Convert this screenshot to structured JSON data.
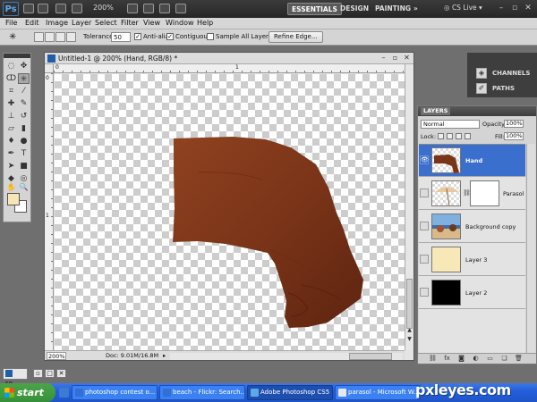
{
  "app": {
    "logo": "Ps",
    "zoom": "200%",
    "workspaces": [
      "ESSENTIALS",
      "DESIGN",
      "PAINTING"
    ],
    "more": "»",
    "cs_live": "CS Live"
  },
  "menu": [
    "File",
    "Edit",
    "Image",
    "Layer",
    "Select",
    "Filter",
    "View",
    "Window",
    "Help"
  ],
  "options": {
    "tolerance_label": "Tolerance:",
    "tolerance_value": "50",
    "anti_alias": "Anti-alias",
    "contiguous": "Contiguous",
    "sample_all": "Sample All Layers",
    "refine_edge": "Refine Edge..."
  },
  "document": {
    "title": "Untitled-1 @ 200% (Hand, RGB/8) *",
    "ruler_h": [
      "0",
      "1"
    ],
    "ruler_v": [
      "0",
      "1"
    ],
    "zoom": "200%",
    "doc_info": "Doc: 9.01M/16.8M"
  },
  "dock": {
    "channels": "CHANNELS",
    "paths": "PATHS"
  },
  "layers_panel": {
    "tab": "LAYERS",
    "blend_mode": "Normal",
    "opacity_label": "Opacity:",
    "opacity": "100%",
    "lock_label": "Lock:",
    "fill_label": "Fill:",
    "fill": "100%",
    "layers": [
      {
        "name": "Hand",
        "selected": true,
        "visible": true,
        "thumb": "hand"
      },
      {
        "name": "Parasol",
        "selected": false,
        "visible": false,
        "thumb": "parasol"
      },
      {
        "name": "Background copy",
        "selected": false,
        "visible": false,
        "thumb": "beach"
      },
      {
        "name": "Layer 3",
        "selected": false,
        "visible": false,
        "thumb": "#f8e8b8"
      },
      {
        "name": "Layer 2",
        "selected": false,
        "visible": false,
        "thumb": "#000000"
      }
    ]
  },
  "taskbar": {
    "mini_label": "so...",
    "start": "start",
    "tasks": [
      {
        "label": "photoshop contest o...",
        "active": false
      },
      {
        "label": "beach - Flickr: Search...",
        "active": false
      },
      {
        "label": "Adobe Photoshop CS5",
        "active": true
      },
      {
        "label": "parasol - Microsoft W...",
        "active": false
      }
    ]
  },
  "watermark": "pxleyes.com",
  "colors": {
    "foreground": "#f7e5b5",
    "background": "#ffffff",
    "hand_skin": "#8a3e1c",
    "selection": "#3b6fce"
  }
}
